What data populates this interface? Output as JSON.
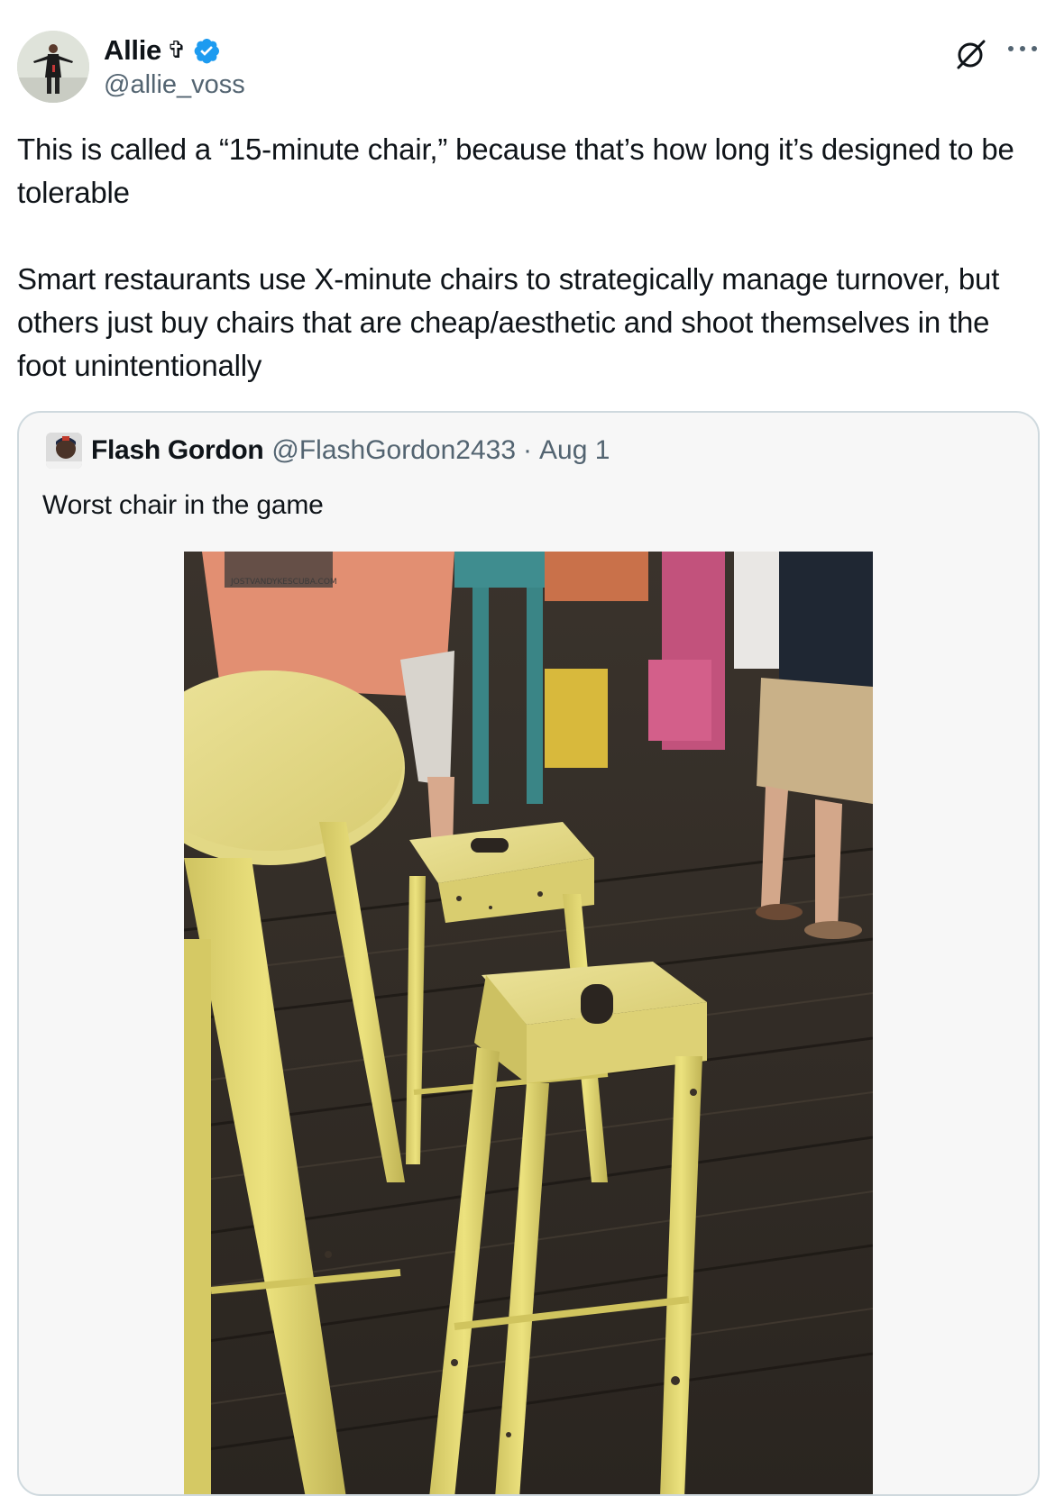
{
  "tweet": {
    "author": {
      "display_name": "Allie",
      "name_emoji": "✞",
      "handle": "@allie_voss",
      "verified": true,
      "verified_color": "#1d9bf0"
    },
    "text_paragraphs": [
      "This is called a “15-minute chair,” because that’s how long it’s designed to be tolerable",
      "Smart restaurants use X-minute chairs to strategically manage turnover, but others just buy chairs that are cheap/aesthetic and shoot themselves in the foot unintentionally"
    ],
    "icons": {
      "grok": "grok-icon",
      "more": "more-icon"
    }
  },
  "quoted_tweet": {
    "author": {
      "display_name": "Flash Gordon",
      "handle": "@FlashGordon2433",
      "separator": "·",
      "date": "Aug 1"
    },
    "text": "Worst chair in the game",
    "image": {
      "shirt_print": "JOSTVANDYKESCUBA.COM"
    }
  }
}
